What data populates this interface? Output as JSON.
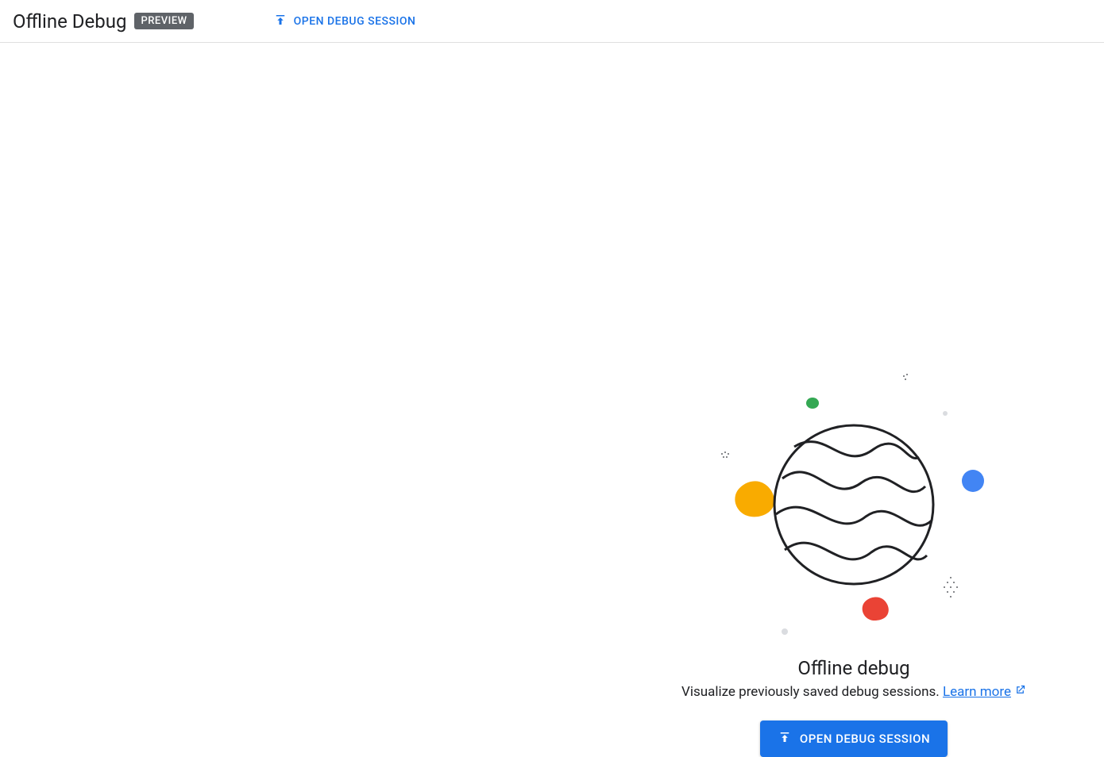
{
  "header": {
    "title": "Offline Debug",
    "badge": "PREVIEW",
    "open_label": "OPEN DEBUG SESSION"
  },
  "empty_state": {
    "title": "Offline debug",
    "subtitle": "Visualize previously saved debug sessions. ",
    "learn_more": "Learn more",
    "open_label": "OPEN DEBUG SESSION"
  },
  "colors": {
    "accent": "#1a73e8",
    "blob_yellow": "#f9ab00",
    "blob_blue": "#4285f4",
    "blob_green": "#34a853",
    "blob_red": "#ea4335",
    "outline": "#202124"
  }
}
